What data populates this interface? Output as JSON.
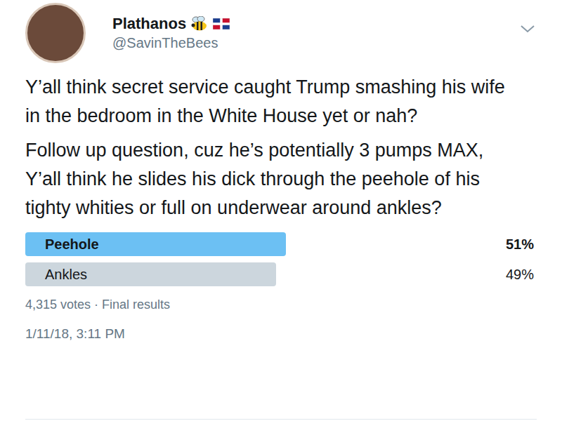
{
  "author": {
    "name": "Plathanos",
    "handle": "@SavinTheBees"
  },
  "tweet": {
    "paragraphs": [
      "Y’all think secret service caught Trump smashing his wife in the bedroom in the White House yet or nah?",
      "Follow up question, cuz he’s potentially 3 pumps MAX, Y’all think he slides his dick through the peehole of his tighty whities or full on underwear around ankles?"
    ]
  },
  "poll": {
    "options": [
      {
        "label": "Peehole",
        "percent": "51%",
        "level": 0.51,
        "selected": true
      },
      {
        "label": "Ankles",
        "percent": "49%",
        "level": 0.49,
        "selected": false
      }
    ],
    "summary": "4,315 votes · Final results"
  },
  "timestamp": "1/11/18, 3:11 PM"
}
